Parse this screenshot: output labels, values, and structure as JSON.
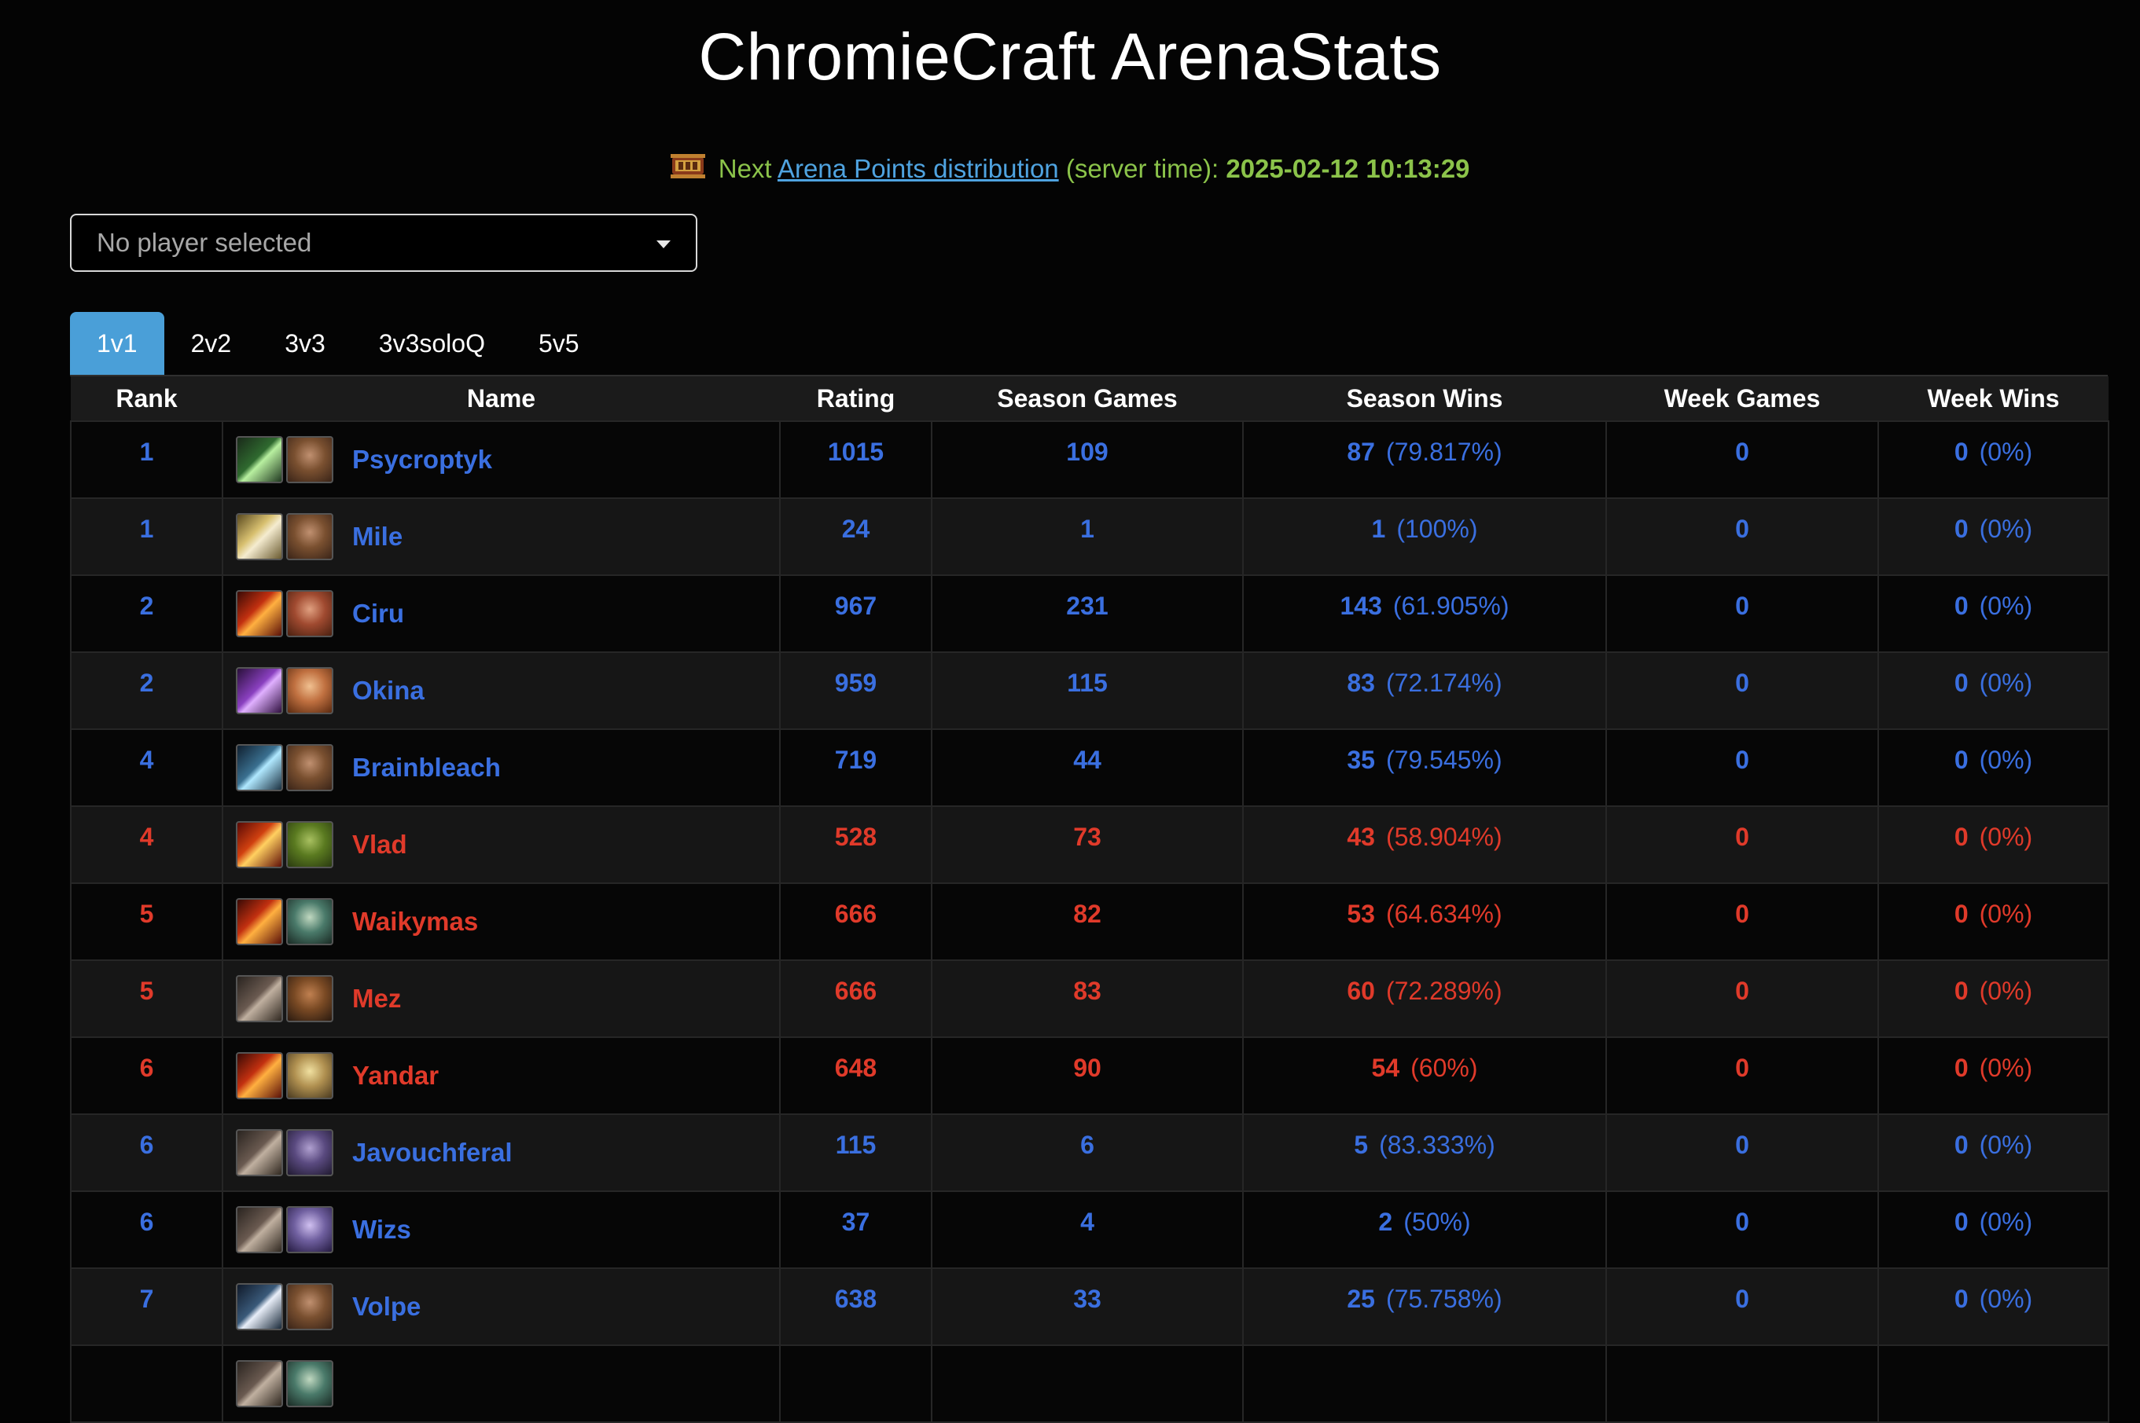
{
  "page": {
    "title": "ChromieCraft ArenaStats"
  },
  "next_distribution": {
    "prefix": "Next",
    "link_text": "Arena Points distribution",
    "suffix": "(server time):",
    "datetime": "2025-02-12 10:13:29",
    "icon": "arena-banner-icon"
  },
  "player_select": {
    "placeholder": "No player selected"
  },
  "tabs": [
    {
      "label": "1v1",
      "active": true
    },
    {
      "label": "2v2",
      "active": false
    },
    {
      "label": "3v3",
      "active": false
    },
    {
      "label": "3v3soloQ",
      "active": false
    },
    {
      "label": "5v5",
      "active": false
    }
  ],
  "columns": [
    "Rank",
    "Name",
    "Rating",
    "Season Games",
    "Season Wins",
    "Week Games",
    "Week Wins"
  ],
  "colors": {
    "alliance": "#3a6fe0",
    "horde": "#e03a2a",
    "accent": "#4a9fd8",
    "highlight": "#8bc34a"
  },
  "rows": [
    {
      "rank": "1",
      "name": "Psycroptyk",
      "faction": "alliance",
      "class_icon": "nature-spear-icon",
      "race_icon": "human-male-icon",
      "rating": "1015",
      "season_games": "109",
      "season_wins": "87",
      "season_pct": "(79.817%)",
      "week_games": "0",
      "week_wins": "0",
      "week_pct": "(0%)"
    },
    {
      "rank": "1",
      "name": "Mile",
      "faction": "alliance",
      "class_icon": "holy-hammer-icon",
      "race_icon": "human-male-icon",
      "rating": "24",
      "season_games": "1",
      "season_wins": "1",
      "season_pct": "(100%)",
      "week_games": "0",
      "week_wins": "0",
      "week_pct": "(0%)"
    },
    {
      "rank": "2",
      "name": "Ciru",
      "faction": "alliance",
      "class_icon": "fire-spear-icon",
      "race_icon": "dwarf-male-icon",
      "rating": "967",
      "season_games": "231",
      "season_wins": "143",
      "season_pct": "(61.905%)",
      "week_games": "0",
      "week_wins": "0",
      "week_pct": "(0%)"
    },
    {
      "rank": "2",
      "name": "Okina",
      "faction": "alliance",
      "class_icon": "shadow-spell-icon",
      "race_icon": "human-female-icon",
      "rating": "959",
      "season_games": "115",
      "season_wins": "83",
      "season_pct": "(72.174%)",
      "week_games": "0",
      "week_wins": "0",
      "week_pct": "(0%)"
    },
    {
      "rank": "4",
      "name": "Brainbleach",
      "faction": "alliance",
      "class_icon": "frost-wand-icon",
      "race_icon": "human-male-icon",
      "rating": "719",
      "season_games": "44",
      "season_wins": "35",
      "season_pct": "(79.545%)",
      "week_games": "0",
      "week_wins": "0",
      "week_pct": "(0%)"
    },
    {
      "rank": "4",
      "name": "Vlad",
      "faction": "horde",
      "class_icon": "fel-rune-icon",
      "race_icon": "orc-male-icon",
      "rating": "528",
      "season_games": "73",
      "season_wins": "43",
      "season_pct": "(58.904%)",
      "week_games": "0",
      "week_wins": "0",
      "week_pct": "(0%)"
    },
    {
      "rank": "5",
      "name": "Waikymas",
      "faction": "horde",
      "class_icon": "fire-spear-icon",
      "race_icon": "undead-male-icon",
      "rating": "666",
      "season_games": "82",
      "season_wins": "53",
      "season_pct": "(64.634%)",
      "week_games": "0",
      "week_wins": "0",
      "week_pct": "(0%)"
    },
    {
      "rank": "5",
      "name": "Mez",
      "faction": "horde",
      "class_icon": "bear-claw-icon",
      "race_icon": "tauren-male-icon",
      "rating": "666",
      "season_games": "83",
      "season_wins": "60",
      "season_pct": "(72.289%)",
      "week_games": "0",
      "week_wins": "0",
      "week_pct": "(0%)"
    },
    {
      "rank": "6",
      "name": "Yandar",
      "faction": "horde",
      "class_icon": "fire-spear-icon",
      "race_icon": "bloodelf-male-icon",
      "rating": "648",
      "season_games": "90",
      "season_wins": "54",
      "season_pct": "(60%)",
      "week_games": "0",
      "week_wins": "0",
      "week_pct": "(0%)"
    },
    {
      "rank": "6",
      "name": "Javouchferal",
      "faction": "alliance",
      "class_icon": "bear-claw-icon",
      "race_icon": "nightelf-male-icon",
      "rating": "115",
      "season_games": "6",
      "season_wins": "5",
      "season_pct": "(83.333%)",
      "week_games": "0",
      "week_wins": "0",
      "week_pct": "(0%)"
    },
    {
      "rank": "6",
      "name": "Wizs",
      "faction": "alliance",
      "class_icon": "bear-claw-icon",
      "race_icon": "nightelf-female-icon",
      "rating": "37",
      "season_games": "4",
      "season_wins": "2",
      "season_pct": "(50%)",
      "week_games": "0",
      "week_wins": "0",
      "week_pct": "(0%)"
    },
    {
      "rank": "7",
      "name": "Volpe",
      "faction": "alliance",
      "class_icon": "sword-icon",
      "race_icon": "human-male-icon",
      "rating": "638",
      "season_games": "33",
      "season_wins": "25",
      "season_pct": "(75.758%)",
      "week_games": "0",
      "week_wins": "0",
      "week_pct": "(0%)"
    },
    {
      "rank": "",
      "name": "",
      "faction": "horde",
      "class_icon": "bear-claw-icon",
      "race_icon": "undead-male-icon",
      "rating": "",
      "season_games": "",
      "season_wins": "",
      "season_pct": "",
      "week_games": "",
      "week_wins": "",
      "week_pct": ""
    }
  ]
}
